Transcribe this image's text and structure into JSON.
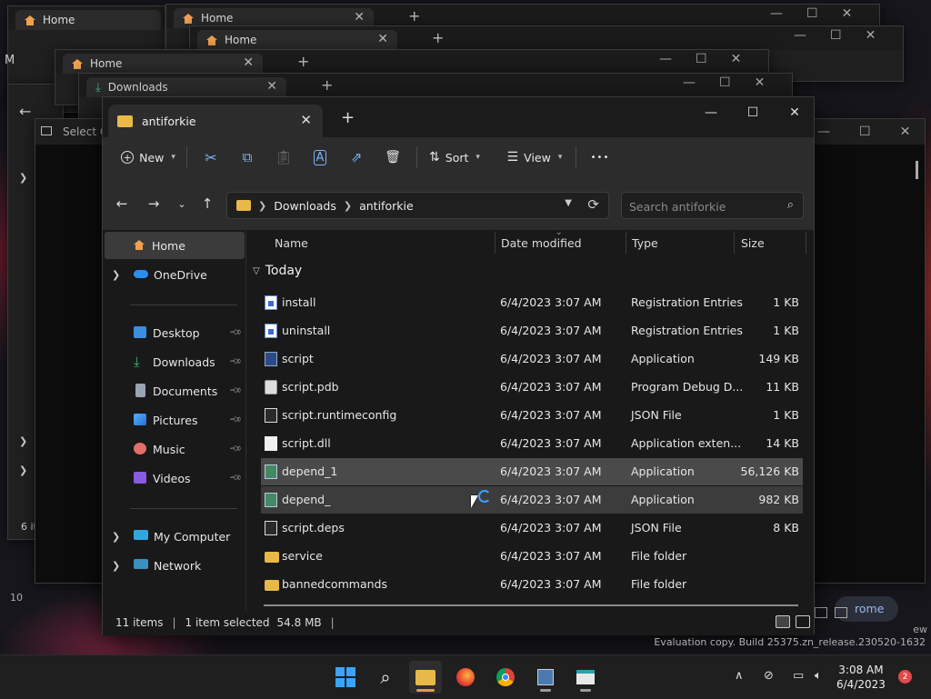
{
  "colors": {
    "accent": "#3aa4ff",
    "folder": "#e8b84a",
    "home": "#f0a050",
    "selection": "#4a4a4a"
  },
  "background_windows": {
    "home_tab_1": "Home",
    "home_tab_2": "Home",
    "home_tab_3": "Home",
    "home_tab_4": "Home",
    "downloads_tab": "Downloads",
    "select_label": "Select C",
    "left_count": "6 it",
    "left_bottom": "10",
    "chrome_label": "rome",
    "ew_label": "ew",
    "m_label": "M"
  },
  "window": {
    "tab_title": "antiforkie",
    "new_tab": "+",
    "minimize": "—",
    "maximize": "☐",
    "close": "✕"
  },
  "toolbar": {
    "new_label": "New",
    "sort_label": "Sort",
    "view_label": "View",
    "more_label": "•••"
  },
  "address": {
    "crumbs": [
      "Downloads",
      "antiforkie"
    ],
    "search_placeholder": "Search antiforkie"
  },
  "sidebar": {
    "items": [
      {
        "label": "Home",
        "icon": "home-icon"
      },
      {
        "label": "OneDrive",
        "icon": "cloud-icon"
      },
      {
        "label": "Desktop",
        "icon": "desktop-icon"
      },
      {
        "label": "Downloads",
        "icon": "download-icon"
      },
      {
        "label": "Documents",
        "icon": "documents-icon"
      },
      {
        "label": "Pictures",
        "icon": "pictures-icon"
      },
      {
        "label": "Music",
        "icon": "music-icon"
      },
      {
        "label": "Videos",
        "icon": "videos-icon"
      },
      {
        "label": "My Computer",
        "icon": "computer-icon"
      },
      {
        "label": "Network",
        "icon": "network-icon"
      }
    ]
  },
  "columns": {
    "name": "Name",
    "date": "Date modified",
    "type": "Type",
    "size": "Size"
  },
  "group_label": "Today",
  "files": [
    {
      "name": "install",
      "date": "6/4/2023 3:07 AM",
      "type": "Registration Entries",
      "size": "1 KB",
      "icon": "registry-icon"
    },
    {
      "name": "uninstall",
      "date": "6/4/2023 3:07 AM",
      "type": "Registration Entries",
      "size": "1 KB",
      "icon": "registry-icon"
    },
    {
      "name": "script",
      "date": "6/4/2023 3:07 AM",
      "type": "Application",
      "size": "149 KB",
      "icon": "application-icon"
    },
    {
      "name": "script.pdb",
      "date": "6/4/2023 3:07 AM",
      "type": "Program Debug D...",
      "size": "11 KB",
      "icon": "pdb-file-icon"
    },
    {
      "name": "script.runtimeconfig",
      "date": "6/4/2023 3:07 AM",
      "type": "JSON File",
      "size": "1 KB",
      "icon": "json-file-icon"
    },
    {
      "name": "script.dll",
      "date": "6/4/2023 3:07 AM",
      "type": "Application exten...",
      "size": "14 KB",
      "icon": "dll-file-icon"
    },
    {
      "name": "depend_1",
      "date": "6/4/2023 3:07 AM",
      "type": "Application",
      "size": "56,126 KB",
      "icon": "application-icon"
    },
    {
      "name": "depend_",
      "date": "6/4/2023 3:07 AM",
      "type": "Application",
      "size": "982 KB",
      "icon": "application-icon"
    },
    {
      "name": "script.deps",
      "date": "6/4/2023 3:07 AM",
      "type": "JSON File",
      "size": "8 KB",
      "icon": "json-file-icon"
    },
    {
      "name": "service",
      "date": "6/4/2023 3:07 AM",
      "type": "File folder",
      "size": "",
      "icon": "folder-icon"
    },
    {
      "name": "bannedcommands",
      "date": "6/4/2023 3:07 AM",
      "type": "File folder",
      "size": "",
      "icon": "folder-icon"
    }
  ],
  "status": {
    "items": "11 items",
    "selected": "1 item selected",
    "size": "54.8 MB",
    "sep": "|"
  },
  "watermark": "Evaluation copy. Build 25375.zn_release.230520-1632",
  "clock": {
    "time": "3:08 AM",
    "date": "6/4/2023"
  },
  "notifications": "2"
}
